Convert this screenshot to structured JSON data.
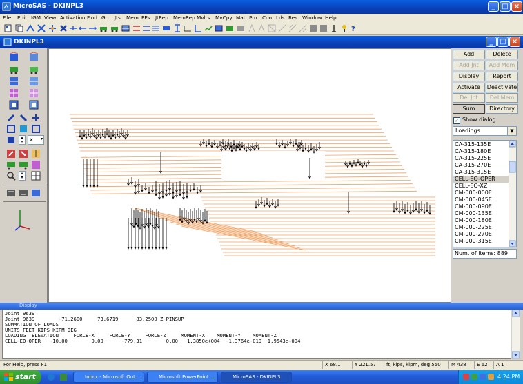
{
  "app": {
    "title": "MicroSAS - DKINPL3",
    "colors": {
      "titlebar": "#0a4ed8",
      "window_bg": "#d4d0c8",
      "canvas": "#ffffff",
      "member_lines": "#f0a060",
      "load_arrows": "#000000"
    }
  },
  "menu": [
    "File",
    "Edit",
    "IGM",
    "View",
    "Activation",
    "Find",
    "Grp",
    "Jts",
    "Mem",
    "FEs",
    "JtRep",
    "MemRep",
    "Mvlts",
    "MvCpy",
    "Mat",
    "Pro",
    "Con",
    "Lds",
    "Res",
    "Window",
    "Help"
  ],
  "toolbar_icons": [
    "new-icon",
    "copy-icon",
    "node-icon",
    "member-icon",
    "axis-icon",
    "move-icon",
    "arrow-left-icon",
    "arrow-right-icon",
    "truss-icon",
    "support-icon",
    "frame-icon",
    "beam-icon",
    "line-icon",
    "line-icon",
    "section-icon",
    "column-icon",
    "wall-icon",
    "level-icon",
    "plate-icon",
    "solid-icon",
    "link-icon",
    "spring-icon",
    "slab-icon",
    "mesh-icon",
    "wall-icon",
    "load-icon",
    "grid-icon",
    "pin-icon",
    "help-icon"
  ],
  "child_window": {
    "title": "DKINPL3"
  },
  "right_panel": {
    "buttons": [
      {
        "label": "Add",
        "enabled": true
      },
      {
        "label": "Delete",
        "enabled": true
      },
      {
        "label": "Add Jnt",
        "enabled": false
      },
      {
        "label": "Add Mem",
        "enabled": false
      },
      {
        "label": "Display",
        "enabled": true
      },
      {
        "label": "Report",
        "enabled": true
      },
      {
        "label": "Activate",
        "enabled": true
      },
      {
        "label": "Deactivate",
        "enabled": true
      },
      {
        "label": "Del Jnt",
        "enabled": false
      },
      {
        "label": "Del Mem",
        "enabled": false
      },
      {
        "label": "Sum",
        "enabled": true
      },
      {
        "label": "Directory",
        "enabled": true
      }
    ],
    "show_dialog": {
      "label": "Show dialog",
      "checked": true
    },
    "combo_value": "Loadings",
    "list_items": [
      "CA-315-135E",
      "CA-315-180E",
      "CA-315-225E",
      "CA-315-270E",
      "CA-315-315E",
      "CELL-EQ-OPER",
      "CELL-EQ-XZ",
      "CM-000-000E",
      "CM-000-045E",
      "CM-000-090E",
      "CM-000-135E",
      "CM-000-180E",
      "CM-000-225E",
      "CM-000-270E",
      "CM-000-315E"
    ],
    "selected_item": "CELL-EQ-OPER",
    "num_items": "Num. of items: 889"
  },
  "output": {
    "title": "Display",
    "lines": [
      "Joint 9639",
      "Joint 9639        -71.2600     73.6719      83.2500 Z-PINSUP",
      "SUMMATION OF LOADS",
      "UNITS FEET KIPS KIPM DEG",
      "LOADING  ELEVATION     FORCE-X     FORCE-Y     FORCE-Z     MOMENT-X    MOMENT-Y    MOMENT-Z",
      "CELL-EQ-OPER   -10.00        0.00      -779.31        0.00   1.3850e+004  -1.3764e-019  1.9543e+004"
    ]
  },
  "status_bar": {
    "help": "For Help, press F1",
    "x": "X 68.1",
    "y": "Y 221.57",
    "units": "ft, kips, kipm, deg",
    "j": "J 550",
    "m": "M 438",
    "e": "E 62",
    "a": "A 1"
  },
  "taskbar": {
    "start": "start",
    "tasks": [
      "Inbox - Microsoft Out...",
      "Microsoft PowerPoint ...",
      "MicroSAS - DKINPL3"
    ],
    "clock": "4:24 PM"
  }
}
